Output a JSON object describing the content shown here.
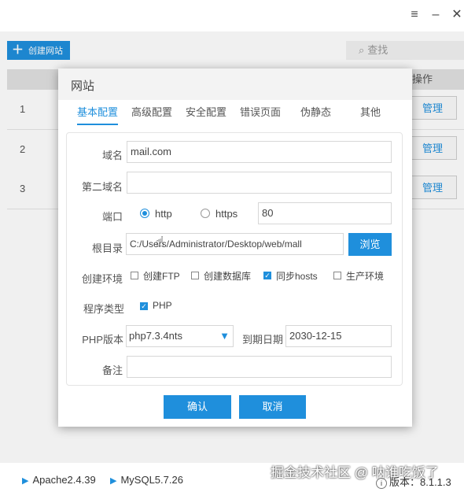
{
  "window": {
    "menu_icon": "≡",
    "minimize_icon": "–",
    "close_icon": "✕"
  },
  "toolbar": {
    "create_site_label": "创建网站",
    "search_placeholder": "查找"
  },
  "table": {
    "ops_header": "操作",
    "rows": [
      {
        "num": "1",
        "action": "管理"
      },
      {
        "num": "2",
        "action": "管理"
      },
      {
        "num": "3",
        "action": "管理"
      }
    ]
  },
  "dialog": {
    "title": "网站",
    "tabs": [
      "基本配置",
      "高级配置",
      "安全配置",
      "错误页面",
      "伪静态",
      "其他"
    ],
    "domain": {
      "label": "域名",
      "value": "mail.com"
    },
    "second_domain": {
      "label": "第二域名",
      "value": ""
    },
    "port": {
      "label": "端口",
      "http_label": "http",
      "https_label": "https",
      "value": "80",
      "selected": "http"
    },
    "root": {
      "label": "根目录",
      "value": "C:/Users/Administrator/Desktop/web/mall",
      "browse_label": "浏览"
    },
    "env": {
      "label": "创建环境",
      "options": [
        {
          "label": "创建FTP",
          "checked": false
        },
        {
          "label": "创建数据库",
          "checked": false
        },
        {
          "label": "同步hosts",
          "checked": true
        },
        {
          "label": "生产环境",
          "checked": false
        }
      ]
    },
    "program_type": {
      "label": "程序类型",
      "option": "PHP",
      "checked": true
    },
    "php_version": {
      "label": "PHP版本",
      "value": "php7.3.4nts"
    },
    "expire": {
      "label": "到期日期",
      "value": "2030-12-15"
    },
    "remark": {
      "label": "备注",
      "value": ""
    },
    "confirm_label": "确认",
    "cancel_label": "取消"
  },
  "statusbar": {
    "apache": "Apache2.4.39",
    "mysql": "MySQL5.7.26",
    "version": "版本：8.1.1.3"
  },
  "watermark": "掘金技术社区 @ 呐谁吃饭了",
  "colors": {
    "accent": "#1f8fdc"
  }
}
